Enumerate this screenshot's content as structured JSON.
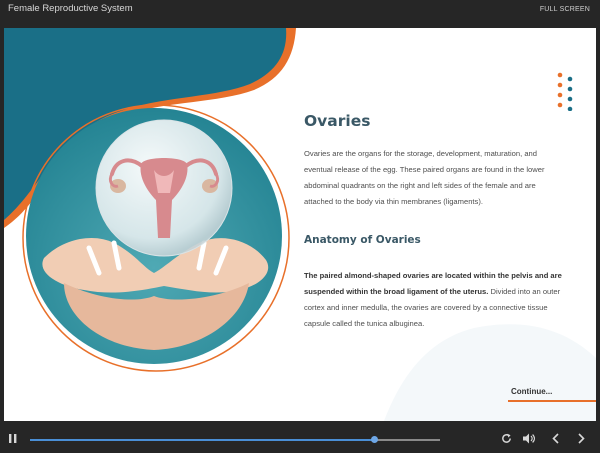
{
  "header": {
    "title": "Female Reproductive System",
    "fullscreen_label": "FULL SCREEN"
  },
  "slide": {
    "heading": "Ovaries",
    "paragraph1": "Ovaries are the organs for the storage, development, maturation, and eventual release of the egg. These paired organs are found in the lower abdominal quadrants on the right and left sides of the female and are attached to the body via thin membranes (ligaments).",
    "subheading": "Anatomy of Ovaries",
    "paragraph2_bold": "The paired almond-shaped ovaries are located within the pelvis and are suspended within the broad ligament of the uterus.",
    "paragraph2_rest": " Divided into an outer cortex and inner medulla, the ovaries are covered by a connective tissue capsule called the tunica albuginea.",
    "continue_label": "Continue..."
  },
  "player": {
    "progress": 0.84,
    "icons": [
      "pause-icon",
      "replay-icon",
      "volume-icon",
      "prev-icon",
      "next-icon"
    ]
  },
  "colors": {
    "teal": "#1a6f87",
    "orange": "#e8702a",
    "heading": "#3a5866",
    "progress": "#4a8fd6"
  }
}
